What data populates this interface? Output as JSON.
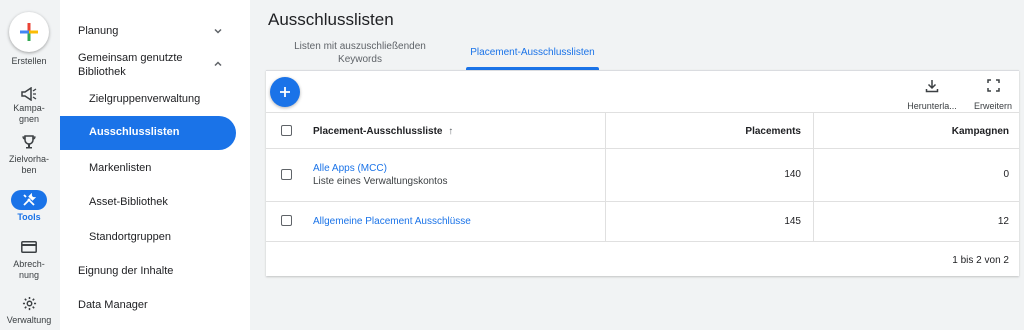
{
  "rail": {
    "create_label": "Erstellen",
    "items": [
      {
        "icon": "campaigns-megaphone-icon",
        "label": "Kampa-\ngnen"
      },
      {
        "icon": "goals-trophy-icon",
        "label": "Zielvorha-\nben"
      },
      {
        "icon": "tools-wrench-icon",
        "label": "Tools"
      },
      {
        "icon": "billing-card-icon",
        "label": "Abrech-\nnung"
      },
      {
        "icon": "admin-gear-icon",
        "label": "Verwaltung"
      }
    ]
  },
  "subnav": {
    "planning": "Planung",
    "shared_library": "Gemeinsam genutzte Bibliothek",
    "items": [
      "Zielgruppenverwaltung",
      "Ausschlusslisten",
      "Markenlisten",
      "Asset-Bibliothek",
      "Standortgruppen"
    ],
    "content_suitability": "Eignung der Inhalte",
    "data_manager": "Data Manager"
  },
  "page": {
    "title": "Ausschlusslisten",
    "tabs": [
      "Listen mit auszuschließenden Keywords",
      "Placement-Ausschlusslisten"
    ],
    "active_tab": 1
  },
  "toolbar": {
    "download_label": "Herunterla...",
    "expand_label": "Erweitern"
  },
  "table": {
    "columns": [
      "Placement-Ausschlussliste",
      "Placements",
      "Kampagnen"
    ],
    "sort_indicator": "↑",
    "rows": [
      {
        "name": "Alle Apps (MCC)",
        "subtitle": "Liste eines Verwaltungskontos",
        "placements": "140",
        "campaigns": "0"
      },
      {
        "name": "Allgemeine Placement Ausschlüsse",
        "subtitle": "",
        "placements": "145",
        "campaigns": "12"
      }
    ],
    "pagination": "1 bis 2 von 2"
  },
  "colors": {
    "accent": "#1a73e8",
    "background": "#f1f3f4"
  }
}
